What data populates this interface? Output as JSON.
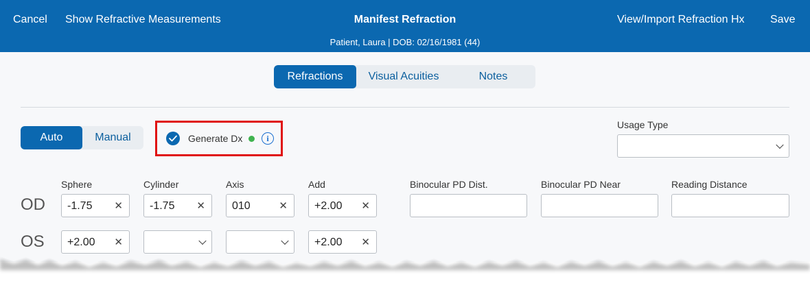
{
  "header": {
    "cancel_label": "Cancel",
    "show_measurements_label": "Show Refractive Measurements",
    "title": "Manifest Refraction",
    "patient_info": "Patient, Laura | DOB: 02/16/1981 (44)",
    "view_import_label": "View/Import Refraction Hx",
    "save_label": "Save"
  },
  "tabs": [
    {
      "label": "Refractions",
      "active": true
    },
    {
      "label": "Visual Acuities",
      "active": false
    },
    {
      "label": "Notes",
      "active": false
    }
  ],
  "mode": {
    "auto_label": "Auto",
    "manual_label": "Manual",
    "selected": "Auto"
  },
  "generate_dx": {
    "label": "Generate Dx",
    "checked": true
  },
  "usage_type": {
    "label": "Usage Type",
    "value": ""
  },
  "columns": {
    "sphere": "Sphere",
    "cylinder": "Cylinder",
    "axis": "Axis",
    "add": "Add",
    "binocular_pd_dist": "Binocular PD Dist.",
    "binocular_pd_near": "Binocular PD Near",
    "reading_distance": "Reading Distance"
  },
  "rows": {
    "od": {
      "label": "OD",
      "sphere": "-1.75",
      "cylinder": "-1.75",
      "axis": "010",
      "add": "+2.00",
      "binocular_pd_dist": "",
      "binocular_pd_near": "",
      "reading_distance": ""
    },
    "os": {
      "label": "OS",
      "sphere": "+2.00",
      "cylinder": "",
      "axis": "",
      "add": "+2.00"
    }
  },
  "icons": {
    "clear": "close-icon",
    "dropdown": "chevron-down-icon",
    "check": "check-icon",
    "info": "info-icon",
    "status_dot": "status-dot-icon"
  },
  "colors": {
    "header_bg": "#0b68b0",
    "accent": "#0b68b0",
    "highlight_border": "#e01010",
    "status_dot": "#3fb34f",
    "info": "#1a6fd0"
  }
}
